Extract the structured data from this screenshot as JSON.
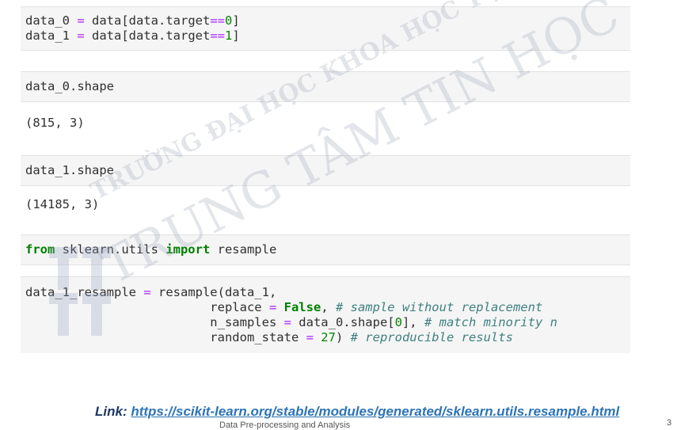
{
  "cells": [
    {
      "lines": [
        [
          {
            "t": "data_0 "
          },
          {
            "t": "=",
            "c": "op"
          },
          {
            "t": " data[data.target"
          },
          {
            "t": "==",
            "c": "op"
          },
          {
            "t": "0",
            "c": "num"
          },
          {
            "t": "]"
          }
        ],
        [
          {
            "t": "data_1 "
          },
          {
            "t": "=",
            "c": "op"
          },
          {
            "t": " data[data.target"
          },
          {
            "t": "==",
            "c": "op"
          },
          {
            "t": "1",
            "c": "num"
          },
          {
            "t": "]"
          }
        ]
      ]
    },
    {
      "lines": [
        [
          {
            "t": "data_0.shape"
          }
        ]
      ],
      "output": "(815, 3)"
    },
    {
      "lines": [
        [
          {
            "t": "data_1.shape"
          }
        ]
      ],
      "output": "(14185, 3)"
    },
    {
      "lines": [
        [
          {
            "t": "from",
            "c": "kw"
          },
          {
            "t": " sklearn.utils "
          },
          {
            "t": "import",
            "c": "kw"
          },
          {
            "t": " resample"
          }
        ]
      ]
    },
    {
      "lines": [
        [
          {
            "t": "data_1_resample "
          },
          {
            "t": "=",
            "c": "op"
          },
          {
            "t": " resample(data_1,"
          }
        ],
        [
          {
            "t": "                         replace "
          },
          {
            "t": "=",
            "c": "op"
          },
          {
            "t": " "
          },
          {
            "t": "False",
            "c": "kw"
          },
          {
            "t": ", "
          },
          {
            "t": "# sample without replacement",
            "c": "cm"
          }
        ],
        [
          {
            "t": "                         n_samples "
          },
          {
            "t": "=",
            "c": "op"
          },
          {
            "t": " data_0.shape["
          },
          {
            "t": "0",
            "c": "num"
          },
          {
            "t": "], "
          },
          {
            "t": "# match minority n",
            "c": "cm"
          }
        ],
        [
          {
            "t": "                         random_state "
          },
          {
            "t": "=",
            "c": "op"
          },
          {
            "t": " "
          },
          {
            "t": "27",
            "c": "num"
          },
          {
            "t": ") "
          },
          {
            "t": "# reproducible results",
            "c": "cm"
          }
        ]
      ]
    }
  ],
  "watermark": {
    "line1": "TRƯỜNG ĐẠI HỌC KHOA HỌC TỰ NHIÊN",
    "line2": "TRUNG TÂM TIN HỌC"
  },
  "link": {
    "label": "Link:",
    "url": "https://scikit-learn.org/stable/modules/generated/sklearn.utils.resample.html"
  },
  "footer": {
    "text": "Data Pre-processing and Analysis",
    "page": "3"
  }
}
